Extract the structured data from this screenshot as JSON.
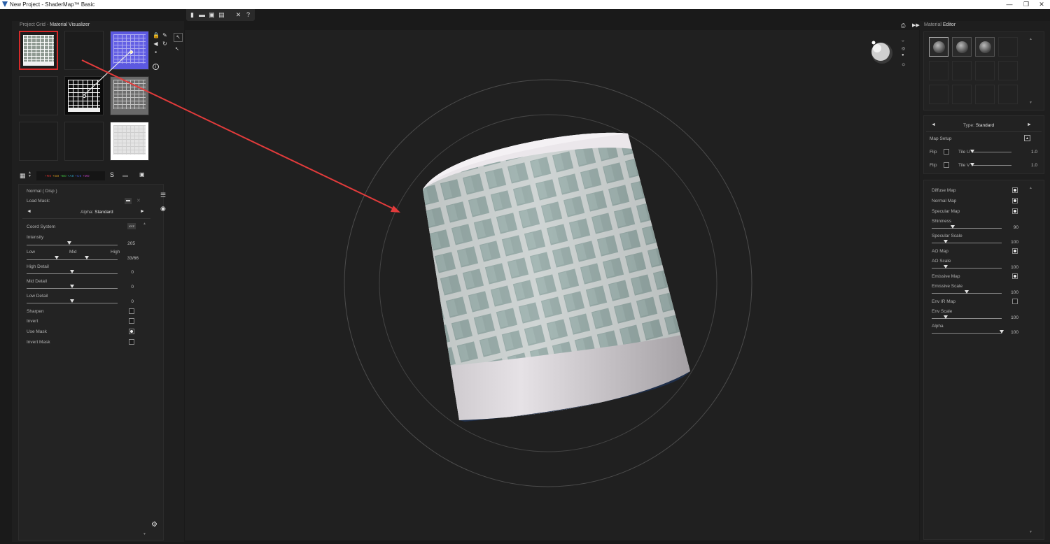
{
  "window": {
    "title": "New Project - ShaderMap™ Basic",
    "minimize": "—",
    "maximize": "❐",
    "close": "✕"
  },
  "toolbar": {
    "icons": [
      "new-icon",
      "open-icon",
      "save-icon",
      "save-as-icon",
      "tools-icon",
      "help-icon"
    ],
    "glyphs": [
      "▮",
      "▬",
      "▣",
      "▤",
      "✕",
      "?"
    ]
  },
  "left_header": {
    "project_grid": "Project Grid",
    "sep": " - ",
    "visualizer": "Material Visualizer"
  },
  "grid_tools": {
    "lock": "🔒",
    "back": "◀",
    "save": "▪",
    "info": "i",
    "pencil": "✎",
    "refresh": "↻"
  },
  "channels": {
    "labels": [
      "+R0",
      "+G0",
      "+B0",
      "+A0",
      "+C0",
      "+M0"
    ],
    "colors": [
      "#e23030",
      "#e0a020",
      "#40c040",
      "#30b0d0",
      "#4060e0",
      "#c040c0"
    ]
  },
  "props": {
    "title": "Normal ( Disp )",
    "load_mask": "Load Mask:",
    "alpha_label": "Alpha:",
    "alpha_value": "Standard",
    "coord_system": "Coord System",
    "coord_btn": "XYZ",
    "intensity": {
      "label": "Intensity",
      "value": "205",
      "level": 0.47
    },
    "lmh": {
      "low": "Low",
      "mid": "Mid",
      "high": "High",
      "value": "33/66",
      "low_level": 0.33,
      "high_level": 0.66
    },
    "high_detail": {
      "label": "High Detail",
      "value": "0",
      "level": 0.5
    },
    "mid_detail": {
      "label": "Mid Detail",
      "value": "0",
      "level": 0.5
    },
    "low_detail": {
      "label": "Low Detail",
      "value": "0",
      "level": 0.5
    },
    "sharpen": {
      "label": "Sharpen",
      "checked": false
    },
    "invert": {
      "label": "Invert",
      "checked": false
    },
    "use_mask": {
      "label": "Use Mask",
      "checked": true
    },
    "invert_mask": {
      "label": "Invert Mask",
      "checked": false
    }
  },
  "right": {
    "header_prefix": "Material",
    "header_bold": "Editor",
    "type_label": "Type:",
    "type_value": "Standard",
    "map_setup": "Map Setup",
    "flip": "Flip",
    "tile_u": {
      "label": "Tile U",
      "value": "1.0",
      "level": 0.0
    },
    "tile_v": {
      "label": "Tile V",
      "value": "1.0",
      "level": 0.0
    },
    "diffuse_map": "Diffuse Map",
    "normal_map": "Normal Map",
    "specular_map": "Specular Map",
    "shininess": {
      "label": "Shininess",
      "value": "90",
      "level": 0.3
    },
    "specular_scale": {
      "label": "Specular Scale",
      "value": "100",
      "level": 0.2
    },
    "ao_map": "AO Map",
    "ao_scale": {
      "label": "AO Scale",
      "value": "100",
      "level": 0.2
    },
    "emissive_map": "Emissive Map",
    "emissive_scale": {
      "label": "Emissive Scale",
      "value": "100",
      "level": 0.5
    },
    "env_ir_map": "Env IR Map",
    "env_scale": {
      "label": "Env Scale",
      "value": "100",
      "level": 0.2
    },
    "alpha": {
      "label": "Alpha",
      "value": "100",
      "level": 1.0
    }
  }
}
